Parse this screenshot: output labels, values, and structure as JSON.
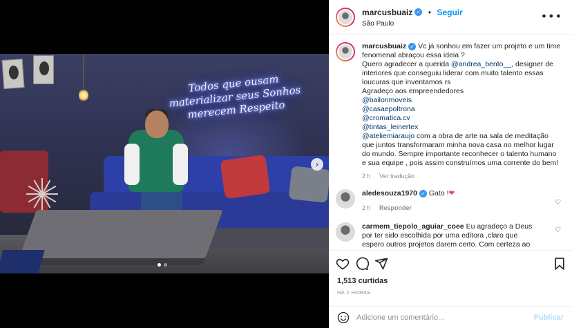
{
  "post": {
    "username": "marcusbuaiz",
    "follow_label": "Seguir",
    "separator": "•",
    "location": "São Paulo",
    "more_icon": "•••",
    "neon_text": [
      "Todos que ousam",
      "materializar seus Sonhos",
      "merecem Respeito"
    ]
  },
  "caption": {
    "username": "marcusbuaiz",
    "lines": [
      "Vc já sonhou em fazer um projeto e um time fenomenal abraçou essa ideia ?",
      "Quero agradecer a querida"
    ],
    "mention1": "@andrea_bento__",
    "after_mention1": ", designer de interiores que conseguiu liderar com muito talento essas loucuras que inventamos rs",
    "thanks_line": "Agradeço aos empreendedores",
    "mentions": [
      "@bailonmoveis",
      "@casaepoltrona",
      "@cromatica.cv",
      "@tintas_leinertex"
    ],
    "mention_last": "@ateliemiaraujo",
    "closing": " com a obra de arte na sala de meditação que juntos transformaram minha nova casa no melhor lugar do mundo. Sempre importante reconhecer o talento humano e sua equipe , pois assim construímos uma corrente do bem!",
    "time": "2 h",
    "translate": "Ver tradução"
  },
  "comments": [
    {
      "username": "aledesouza1970",
      "text": "Gato !",
      "heart": "❤",
      "time": "2 h",
      "reply": "Responder"
    },
    {
      "username": "carmem_tiepolo_aguiar_coee",
      "text": "Eu agradeço a Deus por ter sido escolhida por uma editora ,claro que espero outros projetos darem certo. Com certeza ao darem certo poderei investir"
    }
  ],
  "likes_text": "1,513 curtidas",
  "posted_time": "HÁ 2 HORAS",
  "add_comment": {
    "placeholder": "Adicione um comentário...",
    "publish_label": "Publicar"
  },
  "carousel": {
    "next_icon": "›",
    "current_index": 1,
    "total": 2
  },
  "colors": {
    "link": "#0095f6",
    "mention": "#00376b",
    "verified": "#3897f0"
  }
}
